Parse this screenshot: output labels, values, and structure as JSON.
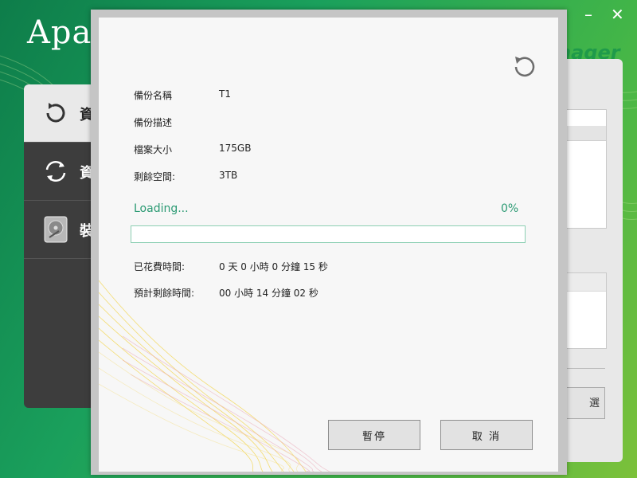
{
  "background_app": {
    "brand": "Apac",
    "manager_label": "nager",
    "window_controls": {
      "minimize": "–",
      "close": "✕"
    },
    "sidebar": [
      {
        "icon": "backup-refresh-icon",
        "label": "資",
        "active": true
      },
      {
        "icon": "sync-icon",
        "label": "資",
        "active": false
      },
      {
        "icon": "hard-drive-icon",
        "label": "裝",
        "active": false
      }
    ],
    "right_button_label": "選"
  },
  "dialog": {
    "refresh_icon": "refresh-icon",
    "info": {
      "backup_name_label": "備份名稱",
      "backup_name_value": "T1",
      "backup_desc_label": "備份描述",
      "backup_desc_value": "",
      "file_size_label": "檔案大小",
      "file_size_value": "175GB",
      "remaining_space_label": "剩餘空間:",
      "remaining_space_value": "3TB"
    },
    "progress": {
      "status_text": "Loading...",
      "percent_text": "0%",
      "fraction": 0
    },
    "time": {
      "elapsed_label": "已花費時間:",
      "elapsed_value": "0 天 0 小時 0 分鐘 15 秒",
      "remaining_label": "預計剩餘時間:",
      "remaining_value": "00 小時 14 分鐘 02 秒"
    },
    "buttons": {
      "pause": "暫停",
      "cancel": "取 消"
    }
  },
  "colors": {
    "accent_green": "#2b9a73",
    "progress_border": "#8ccfb3",
    "bg_green": "#1aa05c"
  }
}
